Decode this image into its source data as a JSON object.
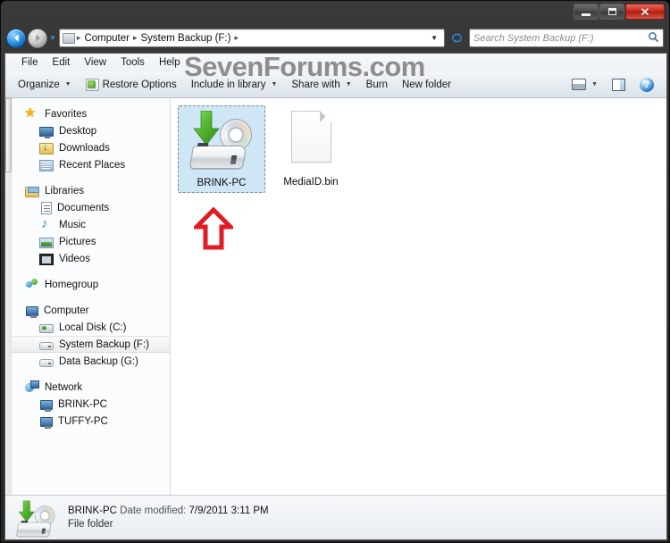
{
  "window": {
    "buttons": {
      "minimize": "Minimize",
      "maximize": "Maximize",
      "close": "Close"
    }
  },
  "navigation": {
    "back_label": "Back",
    "forward_label": "Forward",
    "recent_pages_label": "Recent pages",
    "refresh_label": "Refresh",
    "breadcrumbs": [
      "Computer",
      "System Backup (F:)"
    ],
    "separator": "▸",
    "dropdown_label": "Previous locations"
  },
  "search": {
    "placeholder": "Search System Backup (F:)",
    "value": "",
    "icon": "search-icon"
  },
  "menubar": {
    "items": [
      "File",
      "Edit",
      "View",
      "Tools",
      "Help"
    ]
  },
  "watermark": {
    "text": "SevenForums.com",
    "color": "#8d8d8d"
  },
  "toolbar": {
    "organize": "Organize",
    "restore_options": "Restore Options",
    "include_in_library": "Include in library",
    "share_with": "Share with",
    "burn": "Burn",
    "new_folder": "New folder",
    "change_view_label": "Change your view",
    "view_dropdown_label": "More options",
    "preview_pane_label": "Show the preview pane",
    "help_label": "Help",
    "help_glyph": "?"
  },
  "sidebar": {
    "groups": [
      {
        "header": {
          "label": "Favorites",
          "icon": "star-icon"
        },
        "items": [
          {
            "label": "Desktop",
            "icon": "desktop-icon"
          },
          {
            "label": "Downloads",
            "icon": "downloads-icon"
          },
          {
            "label": "Recent Places",
            "icon": "recent-places-icon"
          }
        ]
      },
      {
        "header": {
          "label": "Libraries",
          "icon": "libraries-icon"
        },
        "items": [
          {
            "label": "Documents",
            "icon": "documents-icon"
          },
          {
            "label": "Music",
            "icon": "music-icon"
          },
          {
            "label": "Pictures",
            "icon": "pictures-icon"
          },
          {
            "label": "Videos",
            "icon": "videos-icon"
          }
        ]
      },
      {
        "header": {
          "label": "Homegroup",
          "icon": "homegroup-icon"
        },
        "items": []
      },
      {
        "header": {
          "label": "Computer",
          "icon": "computer-icon"
        },
        "items": [
          {
            "label": "Local Disk (C:)",
            "icon": "local-disk-icon",
            "selected": false
          },
          {
            "label": "System Backup (F:)",
            "icon": "removable-drive-icon",
            "selected": true
          },
          {
            "label": "Data Backup (G:)",
            "icon": "removable-drive-icon",
            "selected": false
          }
        ]
      },
      {
        "header": {
          "label": "Network",
          "icon": "network-icon"
        },
        "items": [
          {
            "label": "BRINK-PC",
            "icon": "computer-icon"
          },
          {
            "label": "TUFFY-PC",
            "icon": "computer-icon"
          }
        ]
      }
    ]
  },
  "content": {
    "items": [
      {
        "label": "BRINK-PC",
        "icon": "backup-drive-icon",
        "selected": true
      },
      {
        "label": "MediaID.bin",
        "icon": "blank-file-icon",
        "selected": false
      }
    ],
    "annotation": {
      "shape": "up-arrow",
      "color": "#e01b24"
    }
  },
  "details": {
    "icon": "backup-drive-icon",
    "name": "BRINK-PC",
    "date_modified_label": "Date modified:",
    "date_modified_value": "7/9/2011 3:11 PM",
    "type": "File folder"
  }
}
